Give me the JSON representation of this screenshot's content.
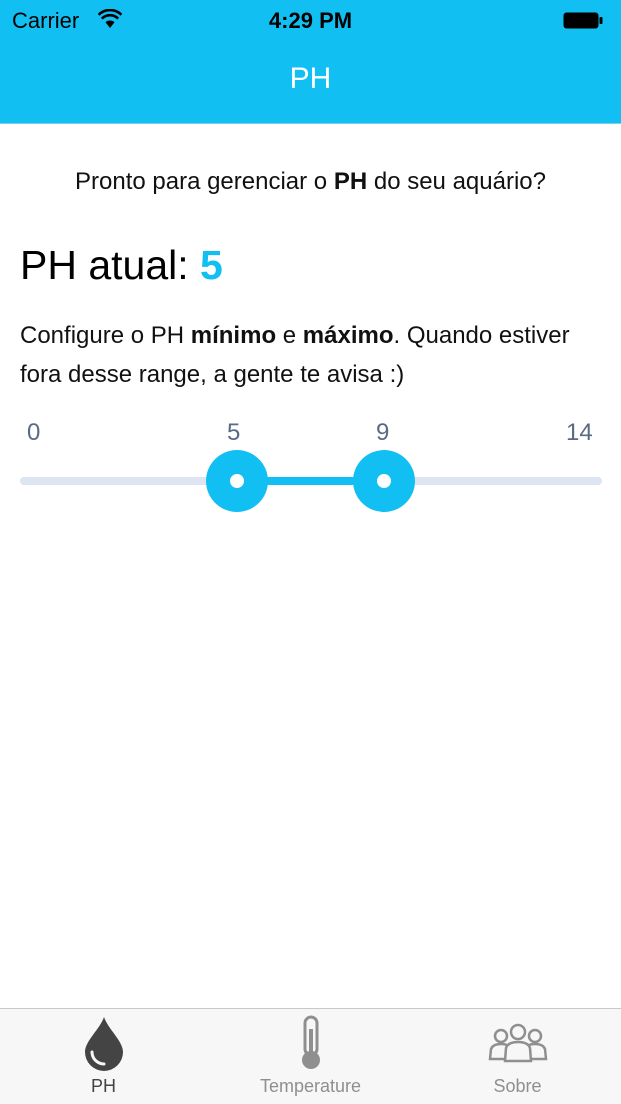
{
  "status_bar": {
    "carrier": "Carrier",
    "time": "4:29 PM"
  },
  "nav": {
    "title": "PH"
  },
  "intro": {
    "before": "Pronto para gerenciar o ",
    "bold": "PH",
    "after": " do seu aquário?"
  },
  "ph": {
    "label": "PH atual: ",
    "value": "5"
  },
  "config": {
    "part1": "Configure o PH ",
    "min_bold": "mínimo",
    "part2": " e ",
    "max_bold": "máximo",
    "part3": ". Quando estiver fora desse range, a gente te avisa :)"
  },
  "slider": {
    "range_min_label": "0",
    "range_max_label": "14",
    "selected_min_label": "5",
    "selected_max_label": "9",
    "selected_min": 5,
    "selected_max": 9,
    "accent_color": "#12bff2",
    "track_color": "#dde5f2"
  },
  "tabs": [
    {
      "label": "PH",
      "icon": "water-drop-icon",
      "active": true
    },
    {
      "label": "Temperature",
      "icon": "thermometer-icon",
      "active": false
    },
    {
      "label": "Sobre",
      "icon": "people-icon",
      "active": false
    }
  ],
  "colors": {
    "accent": "#12bff2",
    "background": "#ffffff"
  }
}
